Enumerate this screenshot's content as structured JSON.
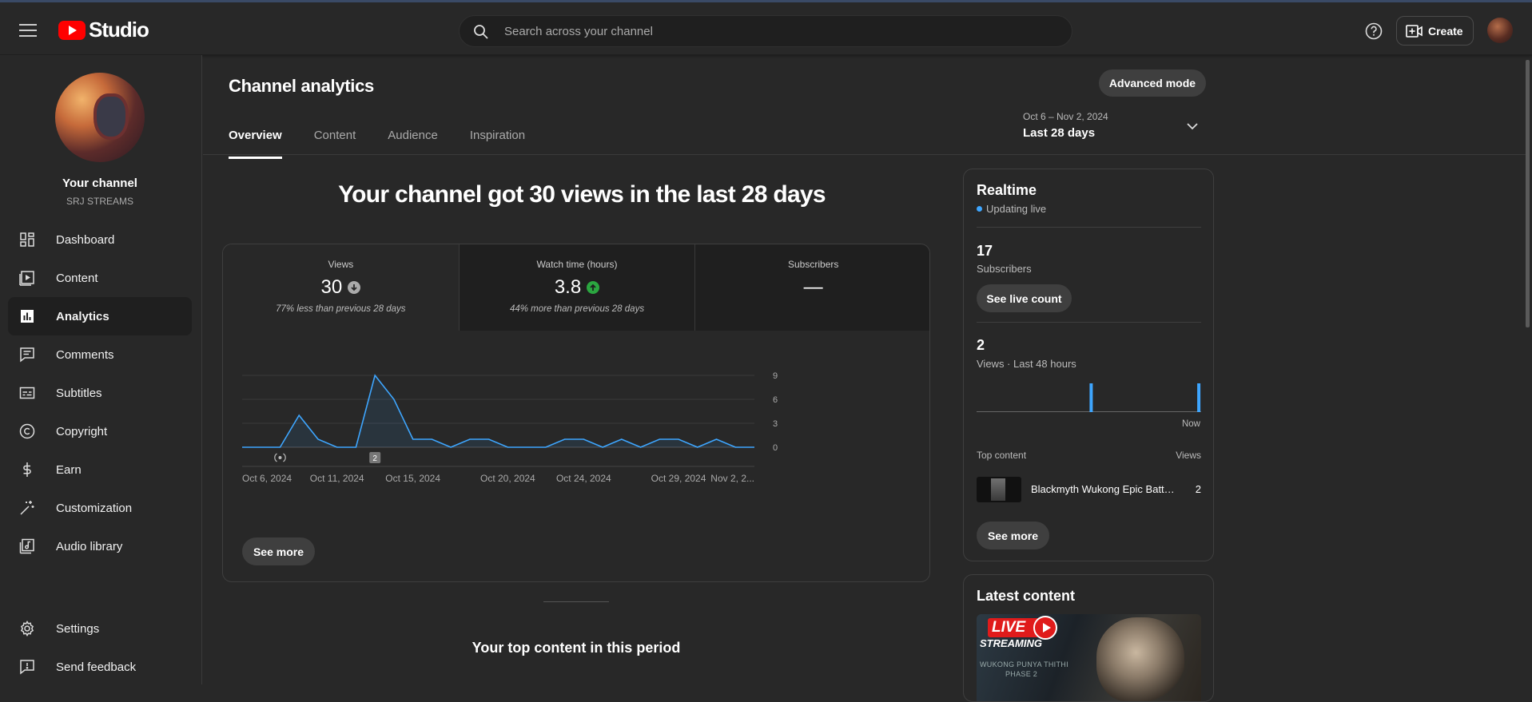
{
  "app": {
    "logo_text": "Studio"
  },
  "search": {
    "placeholder": "Search across your channel"
  },
  "header": {
    "create_label": "Create"
  },
  "channel": {
    "title": "Your channel",
    "handle": "SRJ STREAMS"
  },
  "sidebar": {
    "items": [
      {
        "label": "Dashboard",
        "icon": "dashboard-icon"
      },
      {
        "label": "Content",
        "icon": "content-icon"
      },
      {
        "label": "Analytics",
        "icon": "analytics-icon",
        "active": true
      },
      {
        "label": "Comments",
        "icon": "comments-icon"
      },
      {
        "label": "Subtitles",
        "icon": "subtitles-icon"
      },
      {
        "label": "Copyright",
        "icon": "copyright-icon"
      },
      {
        "label": "Earn",
        "icon": "dollar-icon"
      },
      {
        "label": "Customization",
        "icon": "magic-wand-icon"
      },
      {
        "label": "Audio library",
        "icon": "audio-library-icon"
      }
    ],
    "bottom": [
      {
        "label": "Settings",
        "icon": "gear-icon"
      },
      {
        "label": "Send feedback",
        "icon": "feedback-icon"
      }
    ]
  },
  "page": {
    "title": "Channel analytics",
    "advanced_label": "Advanced mode",
    "tabs": [
      "Overview",
      "Content",
      "Audience",
      "Inspiration"
    ],
    "date_range": {
      "dates": "Oct 6 – Nov 2, 2024",
      "label": "Last 28 days"
    },
    "headline": "Your channel got 30 views in the last 28 days"
  },
  "metrics": [
    {
      "label": "Views",
      "value": "30",
      "note": "77% less than previous 28 days",
      "trend": "down",
      "color": "#aaaaaa"
    },
    {
      "label": "Watch time (hours)",
      "value": "3.8",
      "note": "44% more than previous 28 days",
      "trend": "up",
      "color": "#2ba640"
    },
    {
      "label": "Subscribers",
      "value": "—",
      "note": ""
    }
  ],
  "chart_data": {
    "type": "line",
    "x": [
      "Oct 6",
      "Oct 7",
      "Oct 8",
      "Oct 9",
      "Oct 10",
      "Oct 11",
      "Oct 12",
      "Oct 13",
      "Oct 14",
      "Oct 15",
      "Oct 16",
      "Oct 17",
      "Oct 18",
      "Oct 19",
      "Oct 20",
      "Oct 21",
      "Oct 22",
      "Oct 23",
      "Oct 24",
      "Oct 25",
      "Oct 26",
      "Oct 27",
      "Oct 28",
      "Oct 29",
      "Oct 30",
      "Oct 31",
      "Nov 1",
      "Nov 2"
    ],
    "series": [
      {
        "values": [
          0,
          0,
          0,
          4,
          1,
          0,
          0,
          9,
          6,
          1,
          1,
          0,
          1,
          1,
          0,
          0,
          0,
          1,
          1,
          0,
          1,
          0,
          1,
          1,
          0,
          1,
          0,
          0
        ]
      }
    ],
    "x_tick_labels": [
      "Oct 6, 2024",
      "Oct 11, 2024",
      "Oct 15, 2024",
      "Oct 20, 2024",
      "Oct 24, 2024",
      "Oct 29, 2024",
      "Nov 2, 2..."
    ],
    "y_ticks": [
      0,
      3,
      6,
      9
    ],
    "ylim": [
      0,
      9
    ],
    "color": "#3ea6ff",
    "markers": [
      {
        "x": "Oct 8",
        "icon": "live-icon"
      },
      {
        "x": "Oct 13",
        "label": "2"
      }
    ],
    "grid": true
  },
  "chart_labels": {
    "see_more": "See more"
  },
  "realtime": {
    "title": "Realtime",
    "status": "Updating live",
    "subscribers_value": "17",
    "subscribers_label": "Subscribers",
    "live_count_label": "See live count",
    "views_value": "2",
    "views_label": "Views · Last 48 hours",
    "bars_label": "Now",
    "bars": [
      0,
      0,
      0,
      0,
      0,
      0,
      0,
      0,
      0,
      0,
      0,
      0,
      0,
      0,
      0,
      0,
      0,
      0,
      0,
      0,
      0,
      0,
      0,
      0,
      1,
      0,
      0,
      0,
      0,
      0,
      0,
      0,
      0,
      0,
      0,
      0,
      0,
      0,
      0,
      0,
      0,
      0,
      0,
      0,
      0,
      0,
      0,
      1
    ],
    "top_content_label": "Top content",
    "views_col": "Views",
    "top_item": {
      "title": "Blackmyth Wukong Epic Battl...",
      "views": "2"
    },
    "see_more": "See more"
  },
  "latest": {
    "title": "Latest content",
    "thumb_live": "LIVE",
    "thumb_streaming": "STREAMING",
    "thumb_line1": "WUKONG PUNYA THITHI",
    "thumb_line2": "PHASE 2"
  },
  "top_content_title": "Your top content in this period"
}
